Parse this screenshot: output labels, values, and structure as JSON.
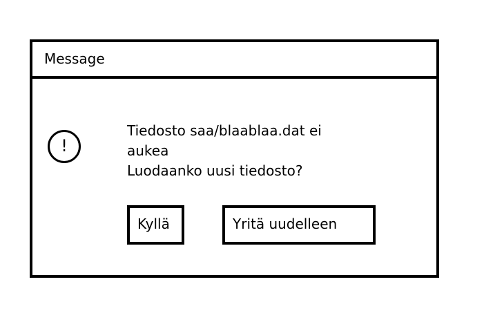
{
  "dialog": {
    "title": "Message",
    "icon": "exclamation-icon",
    "icon_glyph": "!",
    "message_lines": [
      "Tiedosto saa/blaablaa.dat ei",
      "aukea",
      "Luodaanko uusi tiedosto?"
    ],
    "buttons": {
      "yes_label": "Kyllä",
      "retry_label": "Yritä uudelleen"
    }
  }
}
